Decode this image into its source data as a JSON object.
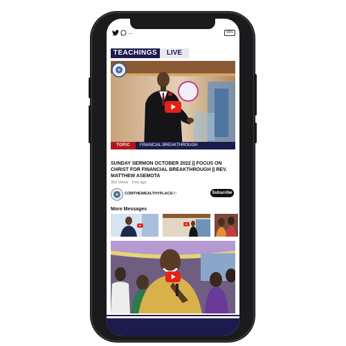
{
  "status_bar": {
    "icons": [
      "twitter-icon",
      "whatsapp-icon"
    ],
    "more": "...",
    "battery": "93%"
  },
  "tabs": [
    {
      "label": "TEACHINGS",
      "active": true
    },
    {
      "label": "LIVE",
      "active": false
    }
  ],
  "featured_video": {
    "topic_label": "TOPIC",
    "topic": "FINANCIAL BREAKTHROUGH",
    "title": "SUNDAY SERMON OCTOBER 2022 || FOCUS ON CHRIST FOR FINANCIAL BREAKTHROUGH || REV. MATTHEW ASEMOTA",
    "meta": "359 Views · 1mo ago",
    "channel_name": "COMTHEWEALTHYPLACE",
    "channel_subs": "500",
    "subscribe_label": "Subscribe"
  },
  "more_messages": {
    "title": "More Messages"
  },
  "colors": {
    "navy": "#1c1b4d",
    "topic_red": "#b0171c",
    "play_red": "#e62117"
  }
}
